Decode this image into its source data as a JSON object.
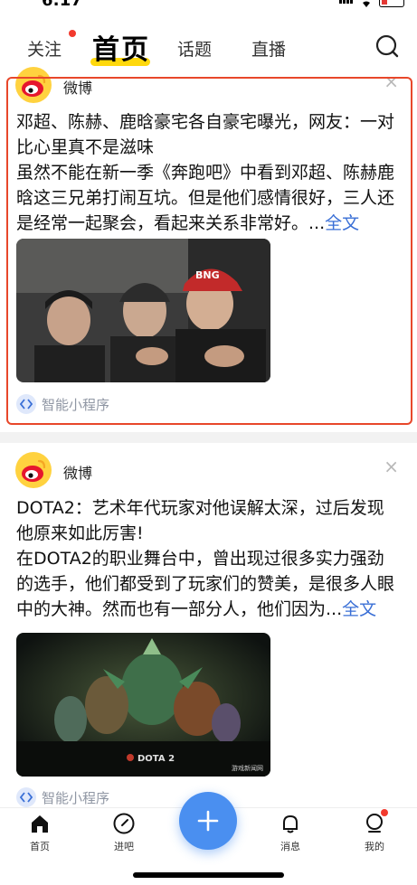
{
  "status_bar": {
    "time": "6:17"
  },
  "top_nav": {
    "tabs": [
      {
        "label": "关注",
        "active": false,
        "has_dot": true
      },
      {
        "label": "首页",
        "active": true
      },
      {
        "label": "话题",
        "active": false
      },
      {
        "label": "直播",
        "active": false
      }
    ],
    "search_icon": "search-icon"
  },
  "feed": [
    {
      "author": "微博",
      "title": "邓超、陈赫、鹿晗豪宅各自豪宅曝光，网友：一对比心里真不是滋味",
      "body": "虽然不能在新一季《奔跑吧》中看到邓超、陈赫鹿晗这三兄弟打闹互坑。但是他们感情很好，三人还是经常一起聚会，看起来关系非常好。...",
      "more_link": "全文",
      "image_desc_icon": "photo-three-men-icon",
      "source": "智能小程序",
      "highlighted": true
    },
    {
      "author": "微博",
      "title": "DOTA2：艺术年代玩家对他误解太深，过后发现他原来如此厉害!",
      "body": "在DOTA2的职业舞台中，曾出现过很多实力强劲的选手，他们都受到了玩家们的赞美，是很多人眼中的大神。然而也有一部分人，他们因为...",
      "more_link": "全文",
      "image_logo_text": "DOTA 2",
      "image_watermark": "游戏新闻网",
      "source": "智能小程序",
      "highlighted": false
    }
  ],
  "bottom_nav": {
    "items": [
      {
        "label": "首页",
        "icon": "home-icon",
        "active": true
      },
      {
        "label": "进吧",
        "icon": "compass-icon",
        "active": false
      },
      {
        "label": "消息",
        "icon": "bell-icon",
        "active": false
      },
      {
        "label": "我的",
        "icon": "profile-icon",
        "active": false,
        "has_dot": true
      }
    ],
    "fab_icon": "plus-icon"
  },
  "colors": {
    "accent_yellow": "#ffd80c",
    "highlight_border": "#e8472a",
    "link_blue": "#3a6fd6",
    "fab_blue": "#4a8ff0",
    "notification_red": "#f23a2e"
  }
}
